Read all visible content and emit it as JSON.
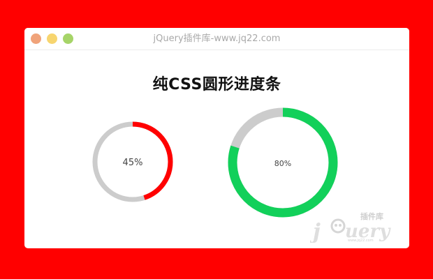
{
  "window": {
    "title": "jQuery插件库-www.jq22.com",
    "dots": [
      {
        "name": "close",
        "color": "#f0a37a"
      },
      {
        "name": "minimize",
        "color": "#f7d56f"
      },
      {
        "name": "maximize",
        "color": "#a6d468"
      }
    ]
  },
  "page": {
    "heading": "纯CSS圆形进度条"
  },
  "progress": [
    {
      "label": "45%",
      "value": 0.45,
      "color": "#ff0000",
      "track": "#cccccc"
    },
    {
      "label": "80%",
      "value": 0.8,
      "color": "#12d05a",
      "track": "#cccccc"
    }
  ],
  "watermark": {
    "brand": "jQuery",
    "tag": "插件库",
    "url": "www.jq22.com"
  }
}
